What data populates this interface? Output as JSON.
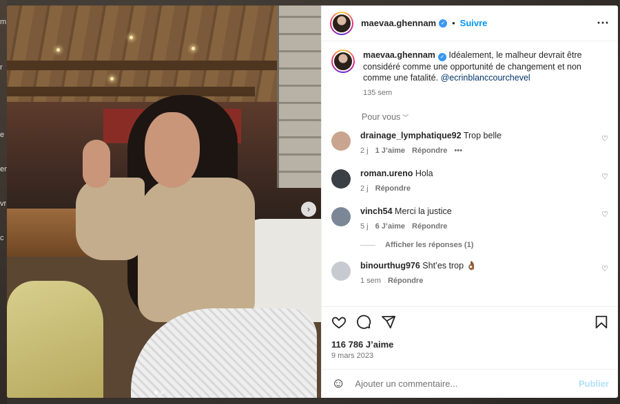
{
  "edge_glyphs": [
    "m",
    "r",
    "e",
    "ent",
    "vr",
    "c"
  ],
  "post": {
    "username": "maevaa.ghennam",
    "separator": "•",
    "follow_label": "Suivre",
    "more_icon": "⋯",
    "caption": "Idéalement, le malheur devrait être considéré comme une opportunité de changement et non comme une fatalité.",
    "caption_mention": "@ecrinblanccourchevel",
    "caption_age": "135 sem",
    "sort_label": "Pour vous",
    "likes": "116 786 J’aime",
    "date": "9 mars 2023",
    "add_comment_placeholder": "Ajouter un commentaire...",
    "publish_label": "Publier"
  },
  "comments": [
    {
      "user": "drainage_lymphatique92",
      "text": "Trop belle",
      "age": "2 j",
      "likes": "1 J’aime",
      "reply": "Répondre",
      "more": "•••",
      "avatar_color": "#c9a48e"
    },
    {
      "user": "roman.ureno",
      "text": "Hola",
      "age": "2 j",
      "likes": "",
      "reply": "Répondre",
      "more": "",
      "avatar_color": "#3b3f46"
    },
    {
      "user": "vinch54",
      "text": "Merci la justice",
      "age": "5 j",
      "likes": "6 J’aime",
      "reply": "Répondre",
      "more": "",
      "avatar_color": "#7b8796"
    },
    {
      "user": "binourthug976",
      "text": "Sht’es trop 👌🏾",
      "age": "1 sem",
      "likes": "",
      "reply": "Répondre",
      "more": "",
      "avatar_color": "#c7cbd1"
    }
  ],
  "show_replies_label": "Afficher les réponses (1)"
}
